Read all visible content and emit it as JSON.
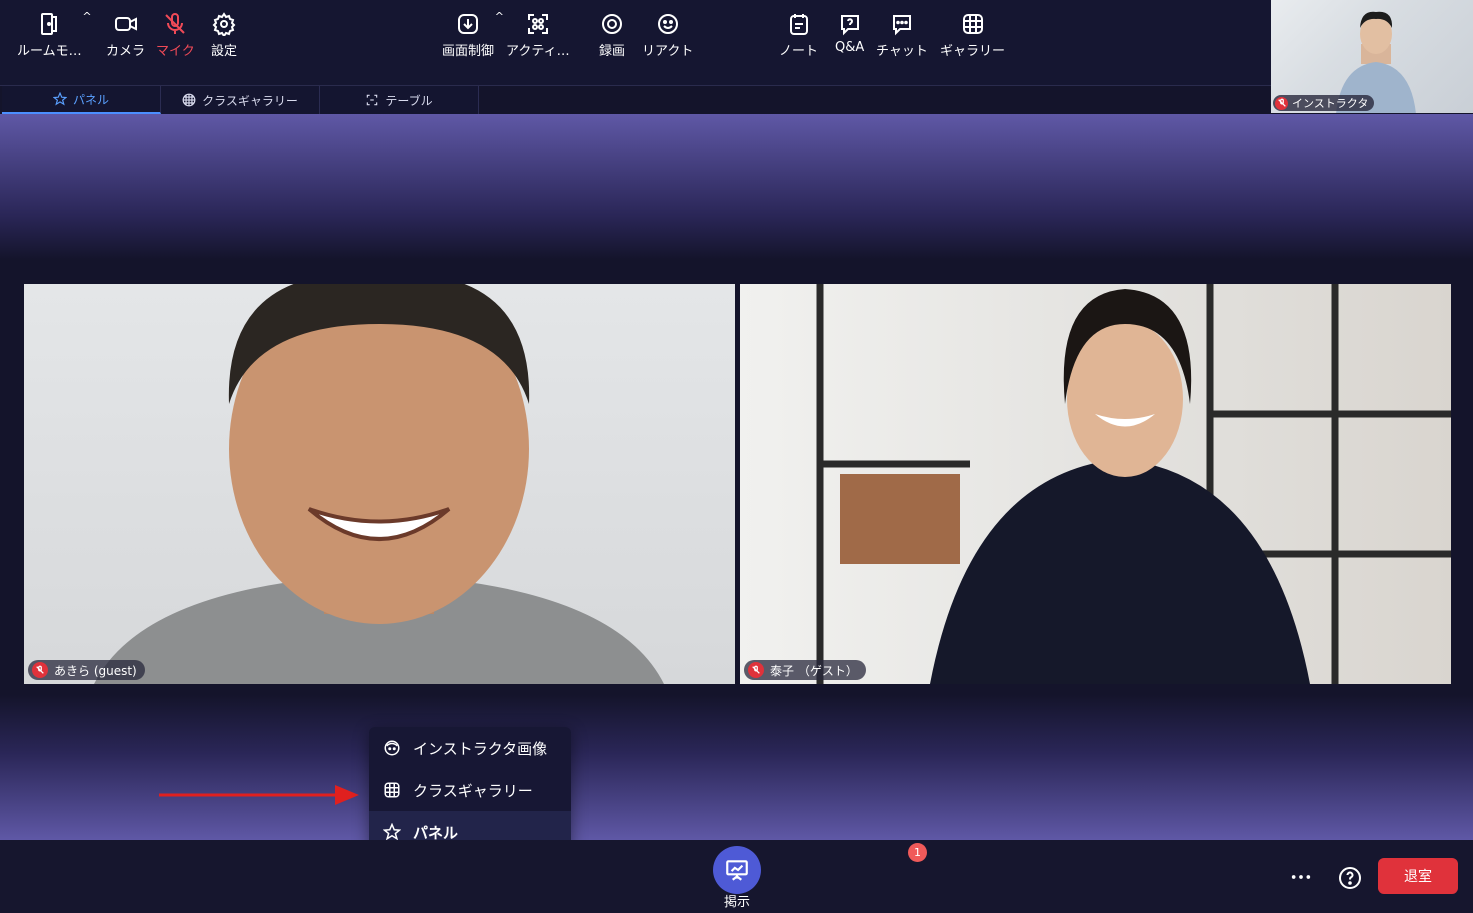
{
  "tabs": [
    {
      "label": "パネル",
      "icon": "star-icon",
      "active": true
    },
    {
      "label": "クラスギャラリー",
      "icon": "grid-icon",
      "active": false
    },
    {
      "label": "テーブル",
      "icon": "table-icon",
      "active": false
    }
  ],
  "instructor": {
    "label": "インストラクタ"
  },
  "participants": [
    {
      "name": "あきら (guest)"
    },
    {
      "name": "泰子 （ゲスト）"
    }
  ],
  "layout_menu": {
    "items": [
      {
        "label": "インストラクタ画像",
        "icon": "face-icon"
      },
      {
        "label": "クラスギャラリー",
        "icon": "grid-icon"
      },
      {
        "label": "パネル",
        "icon": "star-icon",
        "selected": true
      }
    ]
  },
  "toolbar": {
    "room_mode": "ルームモ…",
    "camera": "カメラ",
    "mic": "マイク",
    "settings": "設定",
    "screen_control": "画面制御",
    "activity": "アクティ…",
    "record": "録画",
    "react": "リアクト",
    "present": "掲示",
    "notes": "ノート",
    "qa": "Q&A",
    "chat": "チャット",
    "chat_badge": "1",
    "gallery": "ギャラリー",
    "leave": "退室"
  },
  "colors": {
    "accent": "#4e5ad6",
    "danger": "#e0323b",
    "active_tab": "#5aa0ff"
  }
}
